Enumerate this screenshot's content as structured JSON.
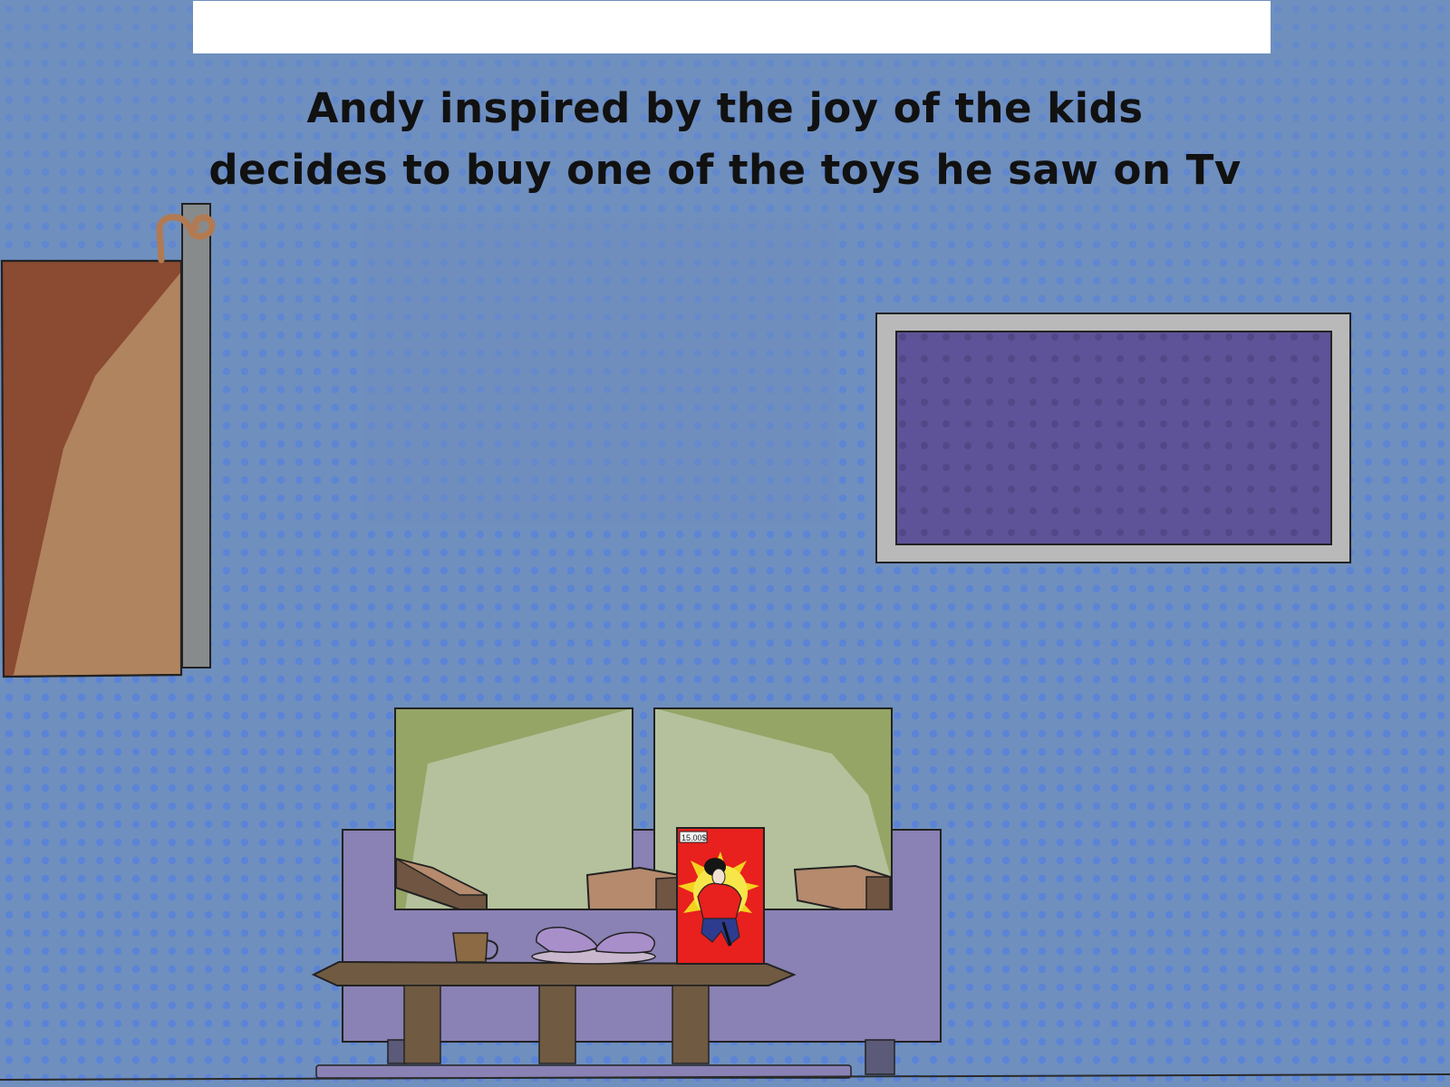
{
  "caption": {
    "line1": "Andy inspired by the joy of the kids",
    "line2": "decides to buy one of the toys he saw on Tv"
  },
  "toy_box": {
    "price_tag": "15.00$"
  },
  "colors": {
    "wall": "#6f8fbe",
    "wall_dots": "#5b84d6",
    "door": "#b0845e",
    "door_shadow": "#8b4a32",
    "tv_screen": "#5e5399",
    "tv_frame": "#b9b9b9",
    "sofa": "#8a81b4",
    "cushion": "#b4c19c",
    "cushion_shade": "#95a566",
    "table": "#705a42",
    "toy_box": "#e8201e"
  }
}
